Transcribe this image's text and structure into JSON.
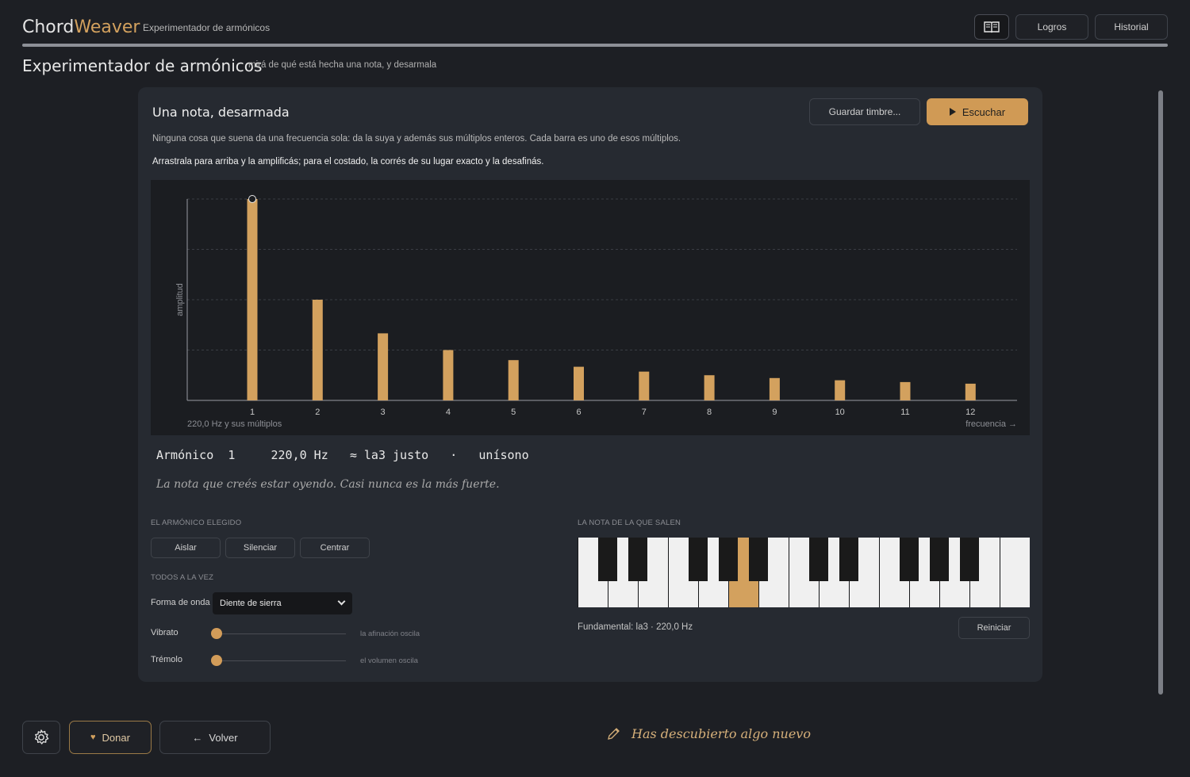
{
  "app": {
    "name_part1": "Chord",
    "name_part2": "Weaver",
    "subtitle": "Experimentador de armónicos",
    "accent_color": "#d3a15e"
  },
  "header": {
    "book_icon": "book-icon",
    "logros_label": "Logros",
    "historial_label": "Historial"
  },
  "page": {
    "title": "Experimentador de armónicos",
    "subtitle": "mirá de qué está hecha una nota, y desarmala"
  },
  "card": {
    "title": "Una nota, desarmada",
    "save_label": "Guardar timbre...",
    "play_label": "Escuchar",
    "desc1": "Ninguna cosa que suena da una frecuencia sola: da la suya y además sus múltiplos enteros. Cada barra es uno de esos múltiplos.",
    "desc2": "Arrastrala para arriba y la amplificás; para el costado, la corrés de su lugar exacto y la desafinás."
  },
  "chart_data": {
    "type": "bar",
    "categories": [
      "1",
      "2",
      "3",
      "4",
      "5",
      "6",
      "7",
      "8",
      "9",
      "10",
      "11",
      "12"
    ],
    "values": [
      1.0,
      0.5,
      0.333,
      0.25,
      0.2,
      0.167,
      0.143,
      0.125,
      0.111,
      0.1,
      0.091,
      0.083
    ],
    "ylabel": "amplitud",
    "xlabel": "frecuencia →",
    "base_label": "220,0 Hz",
    "base_suffix": "y sus múltiplos",
    "ylim": [
      0,
      1
    ],
    "grid": true,
    "selected_index": 0,
    "bar_color": "#d3a15e"
  },
  "readout": {
    "label": "Armónico",
    "number": "1",
    "freq": "220,0 Hz",
    "note": "≈ la3 justo",
    "sep": "·",
    "interval": "unísono",
    "quote": "La nota que creés estar oyendo. Casi nunca es la más fuerte."
  },
  "controls": {
    "selected_section": "EL ARMÓNICO ELEGIDO",
    "isolate": "Aislar",
    "mute": "Silenciar",
    "center": "Centrar",
    "all_section": "TODOS A LA VEZ",
    "waveform_label": "Forma de onda",
    "waveform_value": "Diente de sierra",
    "vibrato_label": "Vibrato",
    "vibrato_hint": "la afinación oscila",
    "vibrato_value": 0,
    "tremolo_label": "Trémolo",
    "tremolo_hint": "el volumen oscila",
    "tremolo_value": 0
  },
  "piano": {
    "section": "LA NOTA DE LA QUE SALEN",
    "fundamental": "Fundamental: la3 · 220,0 Hz",
    "reset": "Reiniciar"
  },
  "footer": {
    "gear_icon": "gear-icon",
    "donate": "Donar",
    "back": "Volver",
    "discovery": "Has descubierto algo nuevo"
  }
}
